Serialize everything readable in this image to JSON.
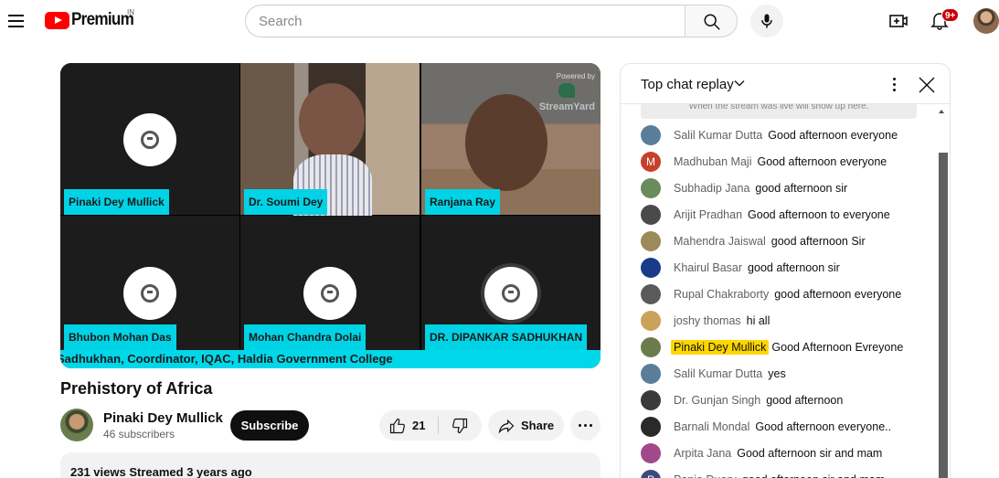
{
  "header": {
    "logo_text": "Premium",
    "logo_region": "IN",
    "search_placeholder": "Search",
    "notification_badge": "9+",
    "icons": [
      "menu-icon",
      "search-icon",
      "mic-icon",
      "create-icon",
      "bell-icon"
    ]
  },
  "video": {
    "participants": [
      {
        "name": "Pinaki Dey Mullick",
        "photo": false
      },
      {
        "name": "Dr. Soumi Dey",
        "photo": true
      },
      {
        "name": "Ranjana Ray",
        "photo": true
      },
      {
        "name": "Bhubon Mohan Das",
        "photo": false
      },
      {
        "name": "Mohan Chandra Dolai",
        "photo": false
      },
      {
        "name": "DR. DIPANKAR SADHUKHAN",
        "photo": false
      }
    ],
    "ticker": "Sadhukhan, Coordinator, IQAC, Haldia Government College",
    "overlay_powered": "Powered by",
    "overlay_brand": "StreamYard"
  },
  "watch": {
    "title": "Prehistory of Africa",
    "channel_name": "Pinaki Dey Mullick",
    "subscribers": "46 subscribers",
    "subscribe_label": "Subscribe",
    "like_count": "21",
    "share_label": "Share",
    "description_meta": "231 views  Streamed 3 years ago"
  },
  "chat": {
    "mode_label": "Top chat replay",
    "pinned_note": "When the stream was live will show up here.",
    "messages": [
      {
        "author": "Salil Kumar Dutta",
        "text": "Good afternoon everyone",
        "avatar_color": "#5a7d9a",
        "initial": ""
      },
      {
        "author": "Madhuban Maji",
        "text": "Good afternoon everyone",
        "avatar_color": "#c6402c",
        "initial": "M"
      },
      {
        "author": "Subhadip Jana",
        "text": "good afternoon sir",
        "avatar_color": "#6a8b5a",
        "initial": ""
      },
      {
        "author": "Arijit Pradhan",
        "text": "Good afternoon to everyone",
        "avatar_color": "#4a4a4a",
        "initial": ""
      },
      {
        "author": "Mahendra Jaiswal",
        "text": "good afternoon Sir",
        "avatar_color": "#9c8a5a",
        "initial": ""
      },
      {
        "author": "Khairul Basar",
        "text": "good afternoon sir",
        "avatar_color": "#1a3a8a",
        "initial": ""
      },
      {
        "author": "Rupal Chakraborty",
        "text": "good afternoon everyone",
        "avatar_color": "#5a5a5a",
        "initial": ""
      },
      {
        "author": "joshy thomas",
        "text": "hi all",
        "avatar_color": "#caa35a",
        "initial": ""
      },
      {
        "author": "Pinaki Dey Mullick",
        "text": "Good Afternoon Evreyone",
        "avatar_color": "#6a7c4c",
        "initial": "",
        "owner": true
      },
      {
        "author": "Salil Kumar Dutta",
        "text": "yes",
        "avatar_color": "#5a7d9a",
        "initial": ""
      },
      {
        "author": "Dr. Gunjan Singh",
        "text": "good afternoon",
        "avatar_color": "#3a3a3a",
        "initial": ""
      },
      {
        "author": "Barnali Mondal",
        "text": "Good afternoon everyone..",
        "avatar_color": "#2a2a2a",
        "initial": ""
      },
      {
        "author": "Arpita Jana",
        "text": "Good afternoon sir and mam",
        "avatar_color": "#a04a8a",
        "initial": ""
      },
      {
        "author": "Papia Duary",
        "text": "good afternoon sir and mam",
        "avatar_color": "#3a4a7a",
        "initial": "P"
      }
    ]
  }
}
